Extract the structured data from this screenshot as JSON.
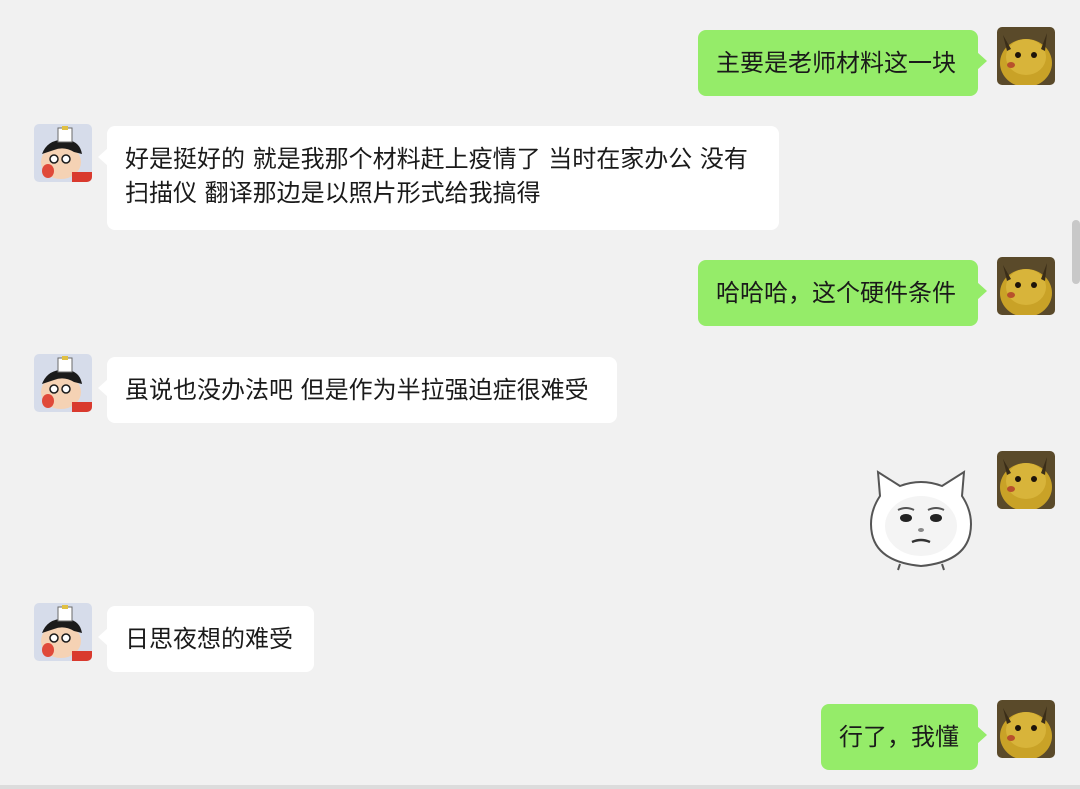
{
  "colors": {
    "background": "#f1f1f1",
    "incoming_bubble": "#ffffff",
    "outgoing_bubble": "#95ec69"
  },
  "avatars": {
    "self": "pikachu-avatar",
    "other": "crayon-shinchan-avatar"
  },
  "messages": [
    {
      "side": "out",
      "text": "主要是老师材料这一块"
    },
    {
      "side": "in",
      "text": "好是挺好的 就是我那个材料赶上疫情了 当时在家办公 没有扫描仪 翻译那边是以照片形式给我搞得"
    },
    {
      "side": "out",
      "text": "哈哈哈，这个硬件条件"
    },
    {
      "side": "in",
      "text": "虽说也没办法吧 但是作为半拉强迫症很难受"
    },
    {
      "side": "out",
      "type": "sticker",
      "sticker": "cat-face-sticker"
    },
    {
      "side": "in",
      "text": "日思夜想的难受"
    },
    {
      "side": "out",
      "text": "行了，我懂"
    }
  ]
}
